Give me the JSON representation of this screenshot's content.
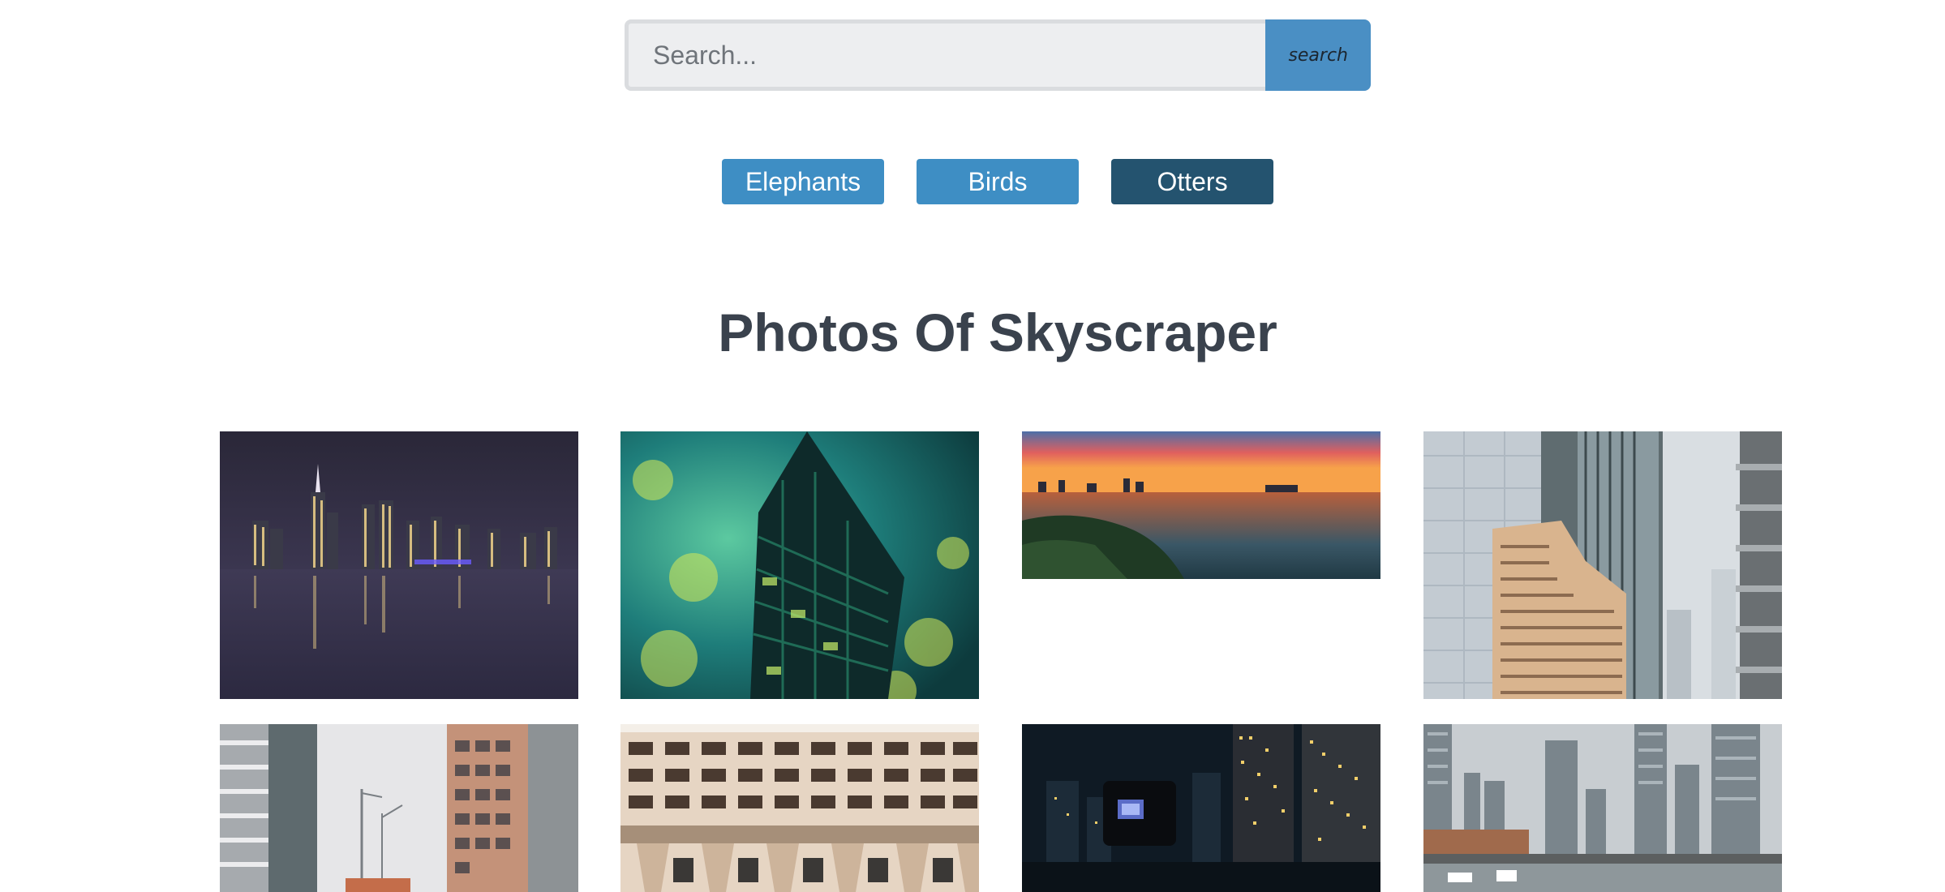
{
  "search": {
    "placeholder": "Search...",
    "button_label": "search"
  },
  "categories": [
    {
      "label": "Elephants",
      "active": false
    },
    {
      "label": "Birds",
      "active": false
    },
    {
      "label": "Otters",
      "active": true
    }
  ],
  "gallery": {
    "title": "Photos Of Skyscraper",
    "photos": [
      {
        "subject": "night city skyline reflected on water"
      },
      {
        "subject": "glass skyscraper with green light reflections"
      },
      {
        "subject": "sunset panorama over river and city"
      },
      {
        "subject": "tan and glass office towers"
      },
      {
        "subject": "construction cranes between residential towers"
      },
      {
        "subject": "brutalist concrete building facade"
      },
      {
        "subject": "camera filming city at night"
      },
      {
        "subject": "waterfront towers on overcast day"
      }
    ]
  },
  "colors": {
    "button_blue": "#3e8ec4",
    "button_active": "#24536f",
    "heading": "#3a424d"
  }
}
